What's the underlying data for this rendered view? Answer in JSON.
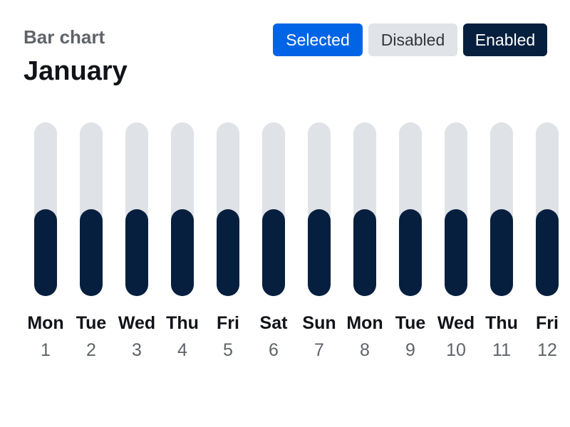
{
  "header": {
    "subtitle": "Bar chart",
    "title": "January"
  },
  "buttons": {
    "selected_label": "Selected",
    "disabled_label": "Disabled",
    "enabled_label": "Enabled"
  },
  "colors": {
    "selected_bg": "#0064e6",
    "selected_fg": "#ffffff",
    "disabled_bg": "#e0e3e7",
    "disabled_fg": "#33363b",
    "enabled_bg": "#061f3f",
    "enabled_fg": "#ffffff",
    "bar_track": "#dfe2e6",
    "bar_fill": "#061f3f",
    "day_label": "#111318",
    "date_label": "#5f6368"
  },
  "chart_data": {
    "type": "bar",
    "categories": [
      "Mon",
      "Tue",
      "Wed",
      "Thu",
      "Fri",
      "Sat",
      "Sun",
      "Mon",
      "Tue",
      "Wed",
      "Thu",
      "Fri"
    ],
    "dates": [
      "1",
      "2",
      "3",
      "4",
      "5",
      "6",
      "7",
      "8",
      "9",
      "10",
      "11",
      "12"
    ],
    "values": [
      0.5,
      0.5,
      0.5,
      0.5,
      0.5,
      0.5,
      0.5,
      0.5,
      0.5,
      0.5,
      0.5,
      0.5
    ],
    "ylim": [
      0,
      1
    ],
    "grid": false,
    "legend": "none"
  }
}
